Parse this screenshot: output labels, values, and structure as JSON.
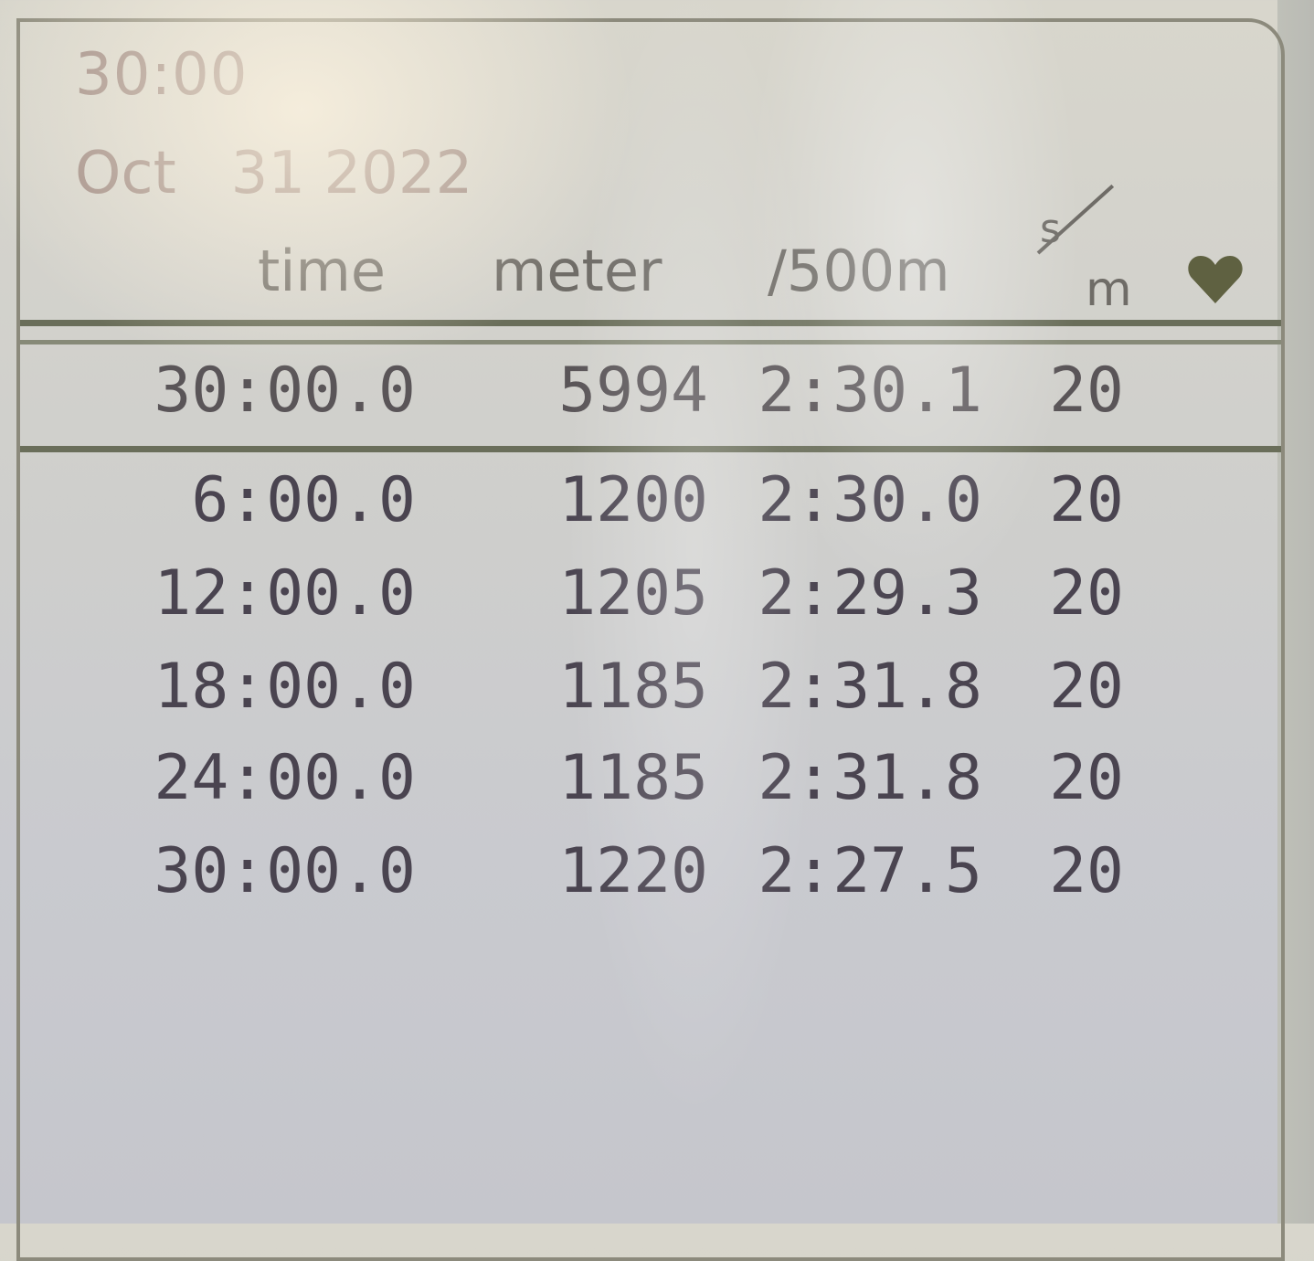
{
  "summary": {
    "duration": "30:00",
    "date_month": "Oct",
    "date_day_year": "31 2022"
  },
  "columns": {
    "time": "time",
    "meter": "meter",
    "pace": "/500m",
    "rate_num": "s",
    "rate_den": "m",
    "heart_icon": "heart-icon"
  },
  "total": {
    "time": "30:00.0",
    "meter": "5994",
    "pace": "2:30.1",
    "rate": "20"
  },
  "splits": [
    {
      "time": "6:00.0",
      "meter": "1200",
      "pace": "2:30.0",
      "rate": "20"
    },
    {
      "time": "12:00.0",
      "meter": "1205",
      "pace": "2:29.3",
      "rate": "20"
    },
    {
      "time": "18:00.0",
      "meter": "1185",
      "pace": "2:31.8",
      "rate": "20"
    },
    {
      "time": "24:00.0",
      "meter": "1185",
      "pace": "2:31.8",
      "rate": "20"
    },
    {
      "time": "30:00.0",
      "meter": "1220",
      "pace": "2:27.5",
      "rate": "20"
    }
  ],
  "colors": {
    "header_text": "#9e8a84",
    "row_text": "#4a4450",
    "heart": "#5f6141",
    "rule": "#6a6e5a"
  }
}
